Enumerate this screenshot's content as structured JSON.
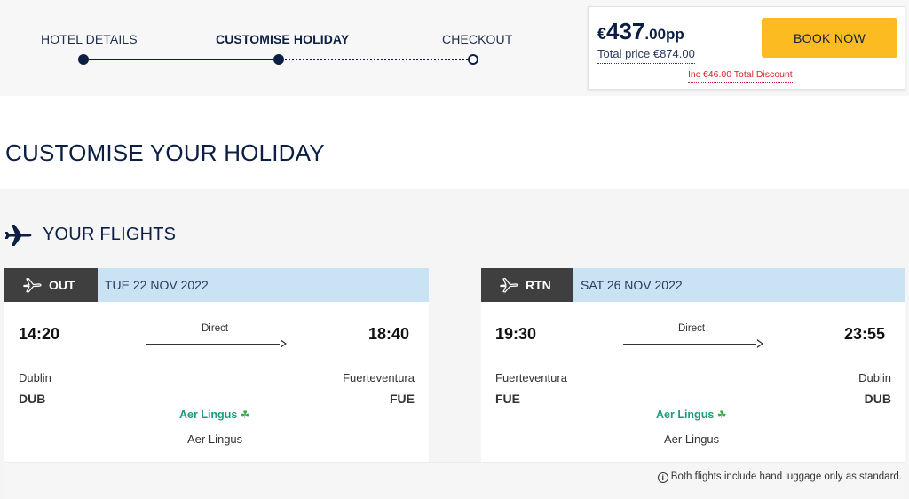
{
  "progress": {
    "steps": [
      {
        "label": "HOTEL DETAILS",
        "state": "done"
      },
      {
        "label": "CUSTOMISE HOLIDAY",
        "state": "current"
      },
      {
        "label": "CHECKOUT",
        "state": "pending"
      }
    ]
  },
  "price": {
    "currency": "€",
    "whole": "437",
    "fraction": ".00pp",
    "total": "Total price €874.00",
    "discount": "Inc €46.00 Total Discount",
    "book_label": "BOOK NOW"
  },
  "page_title": "CUSTOMISE YOUR HOLIDAY",
  "flights": {
    "title": "YOUR FLIGHTS",
    "outbound": {
      "direction": "OUT",
      "date": "TUE 22 NOV 2022",
      "depart_time": "14:20",
      "arrive_time": "18:40",
      "stops": "Direct",
      "from_city": "Dublin",
      "from_code": "DUB",
      "to_city": "Fuerteventura",
      "to_code": "FUE",
      "airline_logo": "Aer Lingus",
      "airline": "Aer Lingus"
    },
    "return": {
      "direction": "RTN",
      "date": "SAT 26 NOV 2022",
      "depart_time": "19:30",
      "arrive_time": "23:55",
      "stops": "Direct",
      "from_city": "Fuerteventura",
      "from_code": "FUE",
      "to_city": "Dublin",
      "to_code": "DUB",
      "airline_logo": "Aer Lingus",
      "airline": "Aer Lingus"
    },
    "note": "Both flights include hand luggage only as standard."
  },
  "colors": {
    "brand_navy": "#0b1f44",
    "cta_yellow": "#fbbb21",
    "discount_red": "#d0252e",
    "date_bar_blue": "#c9e3f5",
    "airline_green": "#1b9c7c"
  },
  "icons": [
    "airplane-icon",
    "plane-takeoff-icon",
    "plane-landing-icon",
    "shamrock-icon",
    "info-icon"
  ]
}
